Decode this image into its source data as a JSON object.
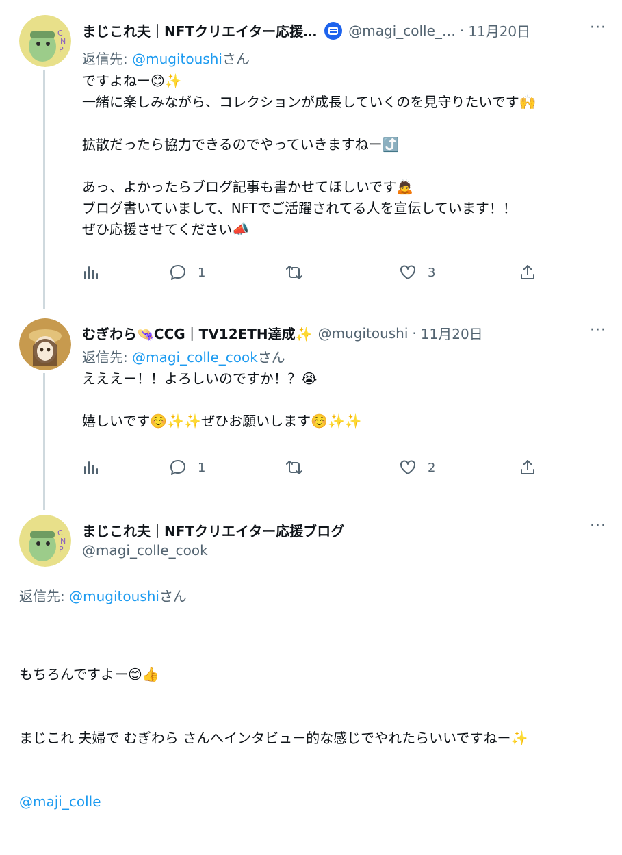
{
  "tweets": [
    {
      "name": "まじこれ夫｜NFTクリエイター応援…",
      "handle": "@magi_colle_…",
      "date": "11月20日",
      "reply_prefix": "返信先: ",
      "reply_mention": "@mugitoushi",
      "reply_suffix": "さん",
      "text": "ですよねー😊✨\n一緒に楽しみながら、コレクションが成長していくのを見守りたいです🙌\n\n拡散だったら協力できるのでやっていきますねー⤴️\n\nあっ、よかったらブログ記事も書かせてほしいです🙇\nブログ書いていまして、NFTでご活躍されてる人を宣伝しています！！\nぜひ応援させてください📣",
      "replies": "1",
      "likes": "3"
    },
    {
      "name": "むぎわら👒CCG｜TV12ETH達成✨",
      "handle": "@mugitoushi",
      "date": "11月20日",
      "reply_prefix": "返信先: ",
      "reply_mention": "@magi_colle_cook",
      "reply_suffix": "さん",
      "text": "えええー！！よろしいのですか！？😭\n\n嬉しいです☺️✨✨ぜひお願いします☺️✨✨",
      "replies": "1",
      "likes": "2"
    },
    {
      "name": "まじこれ夫｜NFTクリエイター応援ブログ",
      "handle": "@magi_colle_cook",
      "reply_prefix": "返信先: ",
      "reply_mention": "@mugitoushi",
      "reply_suffix": "さん",
      "text_line1": "もちろんですよー😊👍",
      "text_line2": "まじこれ 夫婦で むぎわら さんへインタビュー的な感じでやれたらいいですねー✨",
      "text_mention": "@maji_colle"
    }
  ],
  "more_label": "···",
  "colors": {
    "link": "#1d9bf0",
    "muted": "#536471",
    "line": "#cfd9de"
  }
}
